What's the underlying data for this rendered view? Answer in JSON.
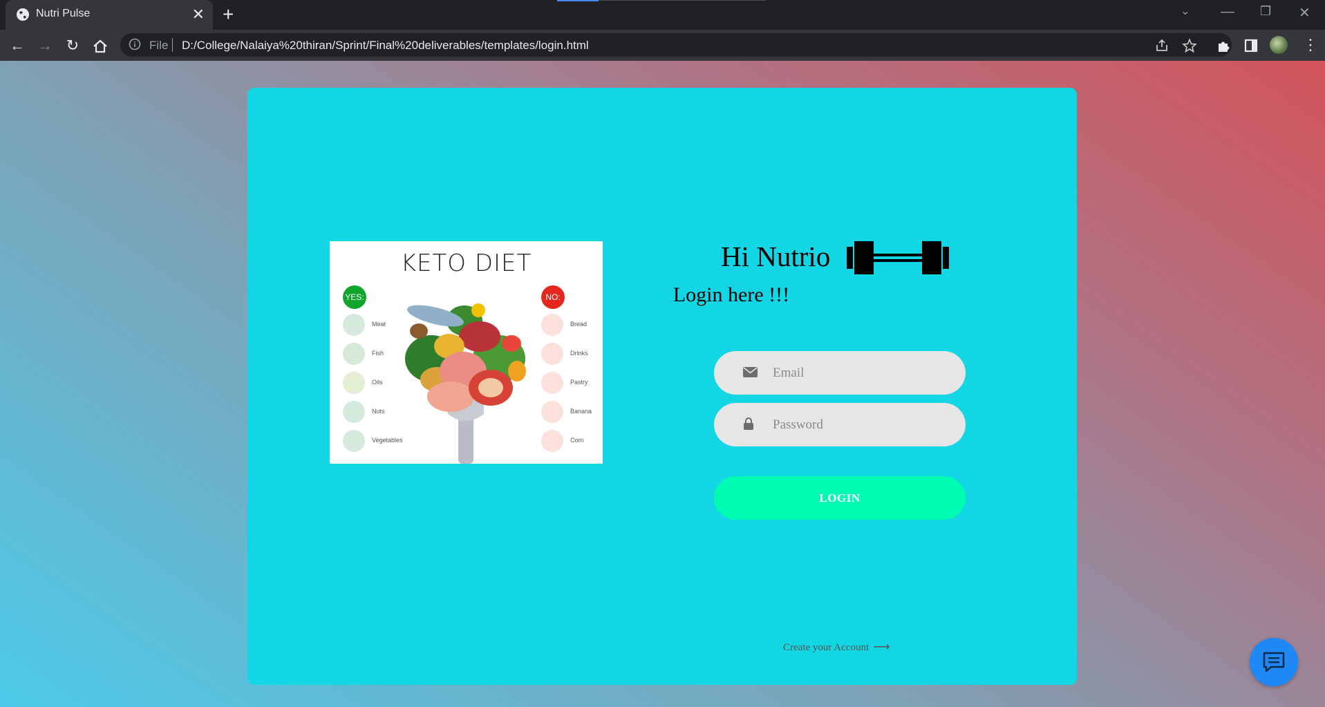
{
  "browser": {
    "tab_title": "Nutri Pulse",
    "new_tab_symbol": "+",
    "file_label": "File",
    "url": "D:/College/Nalaiya%20thiran/Sprint/Final%20deliverables/templates/login.html"
  },
  "keto_image": {
    "title": "KETO DIET",
    "yes_label": "YES:",
    "no_label": "NO:",
    "yes_items": [
      "Meat",
      "Fish",
      "Oils",
      "Nuts",
      "Vegetables"
    ],
    "no_items": [
      "Bread",
      "Drinks",
      "Pastry",
      "Banana",
      "Corn"
    ],
    "yes_color": "#11a52c",
    "no_color": "#e5261c"
  },
  "login": {
    "greeting": "Hi Nutrio",
    "subtitle": "Login here !!!",
    "email_placeholder": "Email",
    "password_placeholder": "Password",
    "login_button": "LOGIN",
    "create_account": "Create your Account",
    "create_arrow": "⟶"
  },
  "colors": {
    "card": "#12d6e3",
    "login_button": "#00fbb3",
    "input_bg": "#e6e6e6",
    "chat_button": "#1e88f5"
  },
  "icons": {
    "email": "envelope-icon",
    "password": "lock-icon",
    "greeting": "dumbbell-icon",
    "chat": "chat-icon"
  }
}
